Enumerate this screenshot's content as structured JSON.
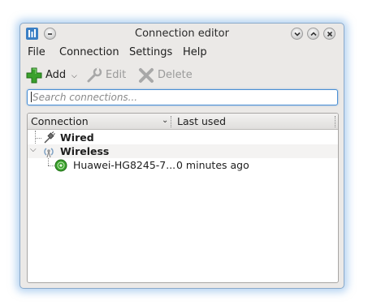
{
  "window": {
    "title": "Connection editor"
  },
  "menubar": {
    "items": [
      "File",
      "Connection",
      "Settings",
      "Help"
    ]
  },
  "toolbar": {
    "add_label": "Add",
    "edit_label": "Edit",
    "delete_label": "Delete"
  },
  "search": {
    "placeholder": "Search connections..."
  },
  "tree": {
    "columns": [
      "Connection",
      "Last used"
    ],
    "groups": [
      {
        "label": "Wired",
        "expanded": false,
        "items": []
      },
      {
        "label": "Wireless",
        "expanded": true,
        "items": [
          {
            "name": "Huawei-HG8245-7...",
            "last_used": "0 minutes ago"
          }
        ]
      }
    ]
  },
  "colors": {
    "selection_border": "#4a8fd4",
    "add_icon_green": "#3aa02c",
    "window_bg": "#ebe9e7",
    "glow": "#78afe6"
  }
}
